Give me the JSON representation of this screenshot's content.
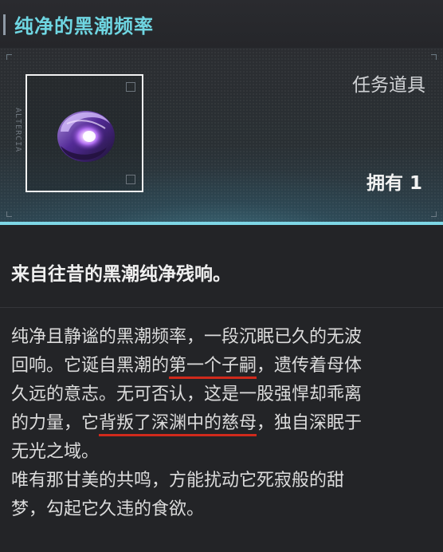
{
  "header": {
    "title": "纯净的黑潮频率"
  },
  "item": {
    "type_label": "任务道具",
    "owned_label": "拥有 1",
    "frame_deco_text": "ALTERCIA",
    "icon": "dark-tide-orb-icon",
    "accent_color": "#7ed7e6",
    "orb_color": "#8a4fd8"
  },
  "subtitle": "来自往昔的黑潮纯净残响。",
  "description": {
    "l1": "纯净且静谧的黑潮频率，一段沉眠已久的无波",
    "l2_a": "回响。它诞自黑潮的",
    "l2_hl": "第一个子嗣",
    "l2_b": "，遗传着母体",
    "l3": "久远的意志。无可否认，这是一股强悍却乖离",
    "l4_a": "的力量，它",
    "l4_hl": "背叛了深渊中的慈母",
    "l4_b": "，独自深眠于",
    "l5": "无光之域。",
    "l6": "唯有那甘美的共鸣，方能扰动它死寂般的甜",
    "l7": "梦，勾起它久违的食欲。",
    "highlight_color": "#d02a1c"
  }
}
